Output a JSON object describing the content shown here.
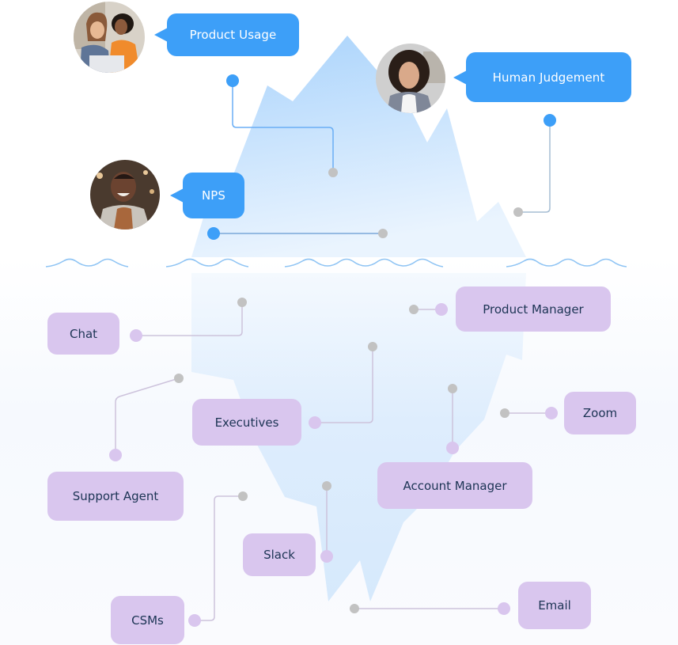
{
  "diagram": {
    "type": "iceberg",
    "colors": {
      "above_accent": "#3d9ff8",
      "below_accent": "#d9c6ee",
      "below_text": "#1c3454",
      "ice_top": "#b7dafd",
      "ice_bottom": "#e6f2fe",
      "connector_gray": "#c2c2c2",
      "wave": "#8fc4f4"
    },
    "above_water": [
      {
        "label": "Product Usage",
        "avatar": "two-women-laptop-photo"
      },
      {
        "label": "Human Judgement",
        "avatar": "curly-haired-woman-photo"
      },
      {
        "label": "NPS",
        "avatar": "smiling-man-photo"
      }
    ],
    "below_water": [
      {
        "label": "Chat"
      },
      {
        "label": "Product Manager"
      },
      {
        "label": "Executives"
      },
      {
        "label": "Zoom"
      },
      {
        "label": "Support Agent"
      },
      {
        "label": "Account Manager"
      },
      {
        "label": "Slack"
      },
      {
        "label": "CSMs"
      },
      {
        "label": "Email"
      }
    ]
  }
}
